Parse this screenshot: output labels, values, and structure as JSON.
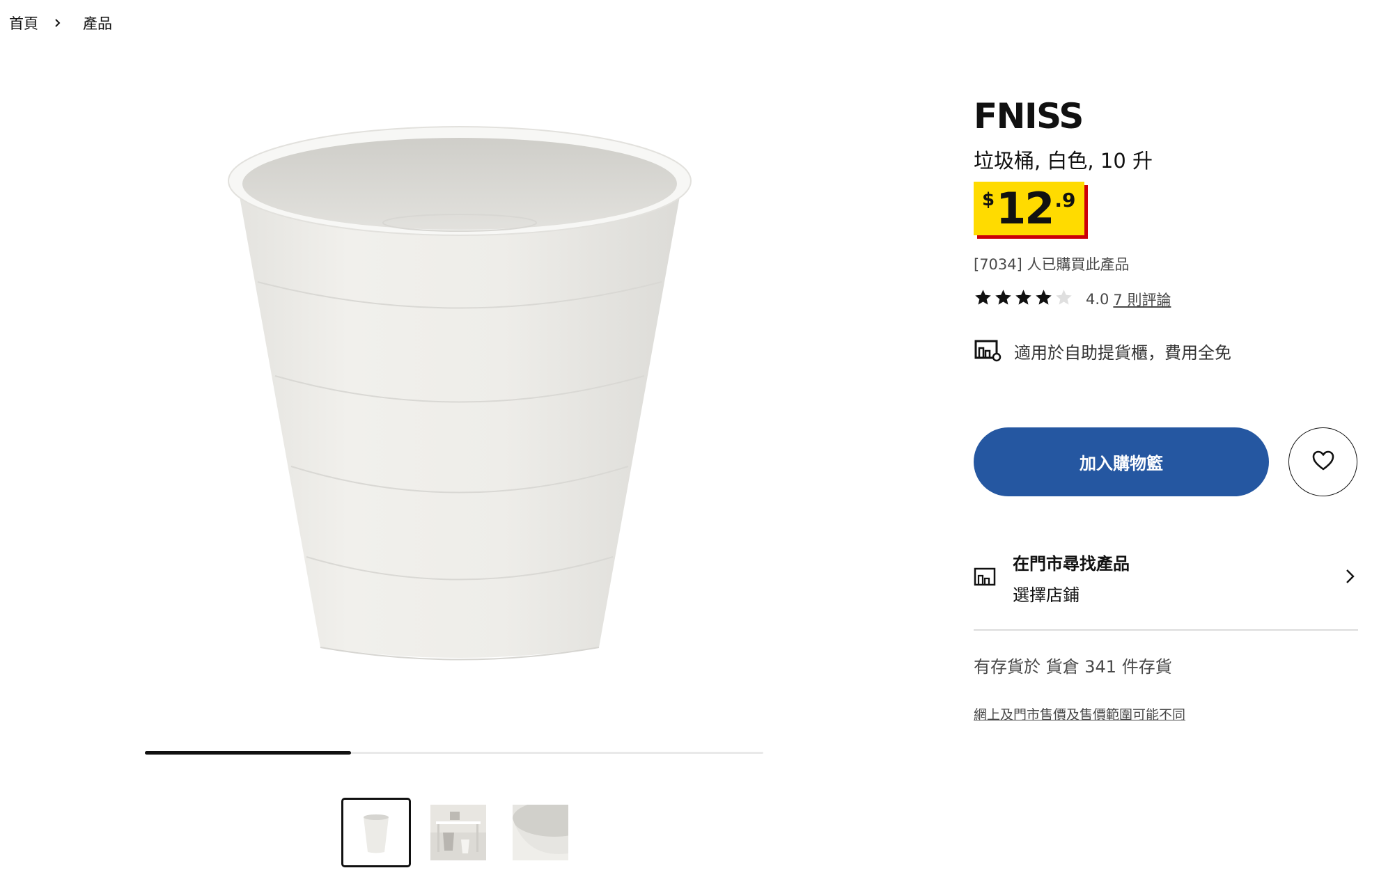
{
  "breadcrumb": {
    "home": "首頁",
    "products": "產品"
  },
  "gallery": {
    "progress": 0.333,
    "thumbnails": [
      {
        "name": "bin-front",
        "active": true
      },
      {
        "name": "bin-in-room",
        "active": false
      },
      {
        "name": "bin-closeup",
        "active": false
      }
    ]
  },
  "product": {
    "name": "FNISS",
    "description": "垃圾桶, 白色, 10 升",
    "price": {
      "currency": "$",
      "integer": "12",
      "decimal": ".9"
    },
    "purchased_text": "[7034] 人已購買此產品",
    "rating": {
      "value": "4.0",
      "stars": 4,
      "max": 5,
      "reviews_link": "7 則評論"
    },
    "pickup_text": "適用於自助提貨櫃，費用全免"
  },
  "actions": {
    "add_to_cart": "加入購物籃",
    "favorite_icon": "heart-icon"
  },
  "store": {
    "title": "在門市尋找產品",
    "subtitle": "選擇店鋪"
  },
  "stock_text": "有存貨於 貨倉 341 件存貨",
  "disclaimer": "網上及門市售價及售價範圍可能不同",
  "colors": {
    "cart_button": "#2557a1",
    "price_bg": "#ffdb00",
    "price_shadow": "#cc0008"
  }
}
